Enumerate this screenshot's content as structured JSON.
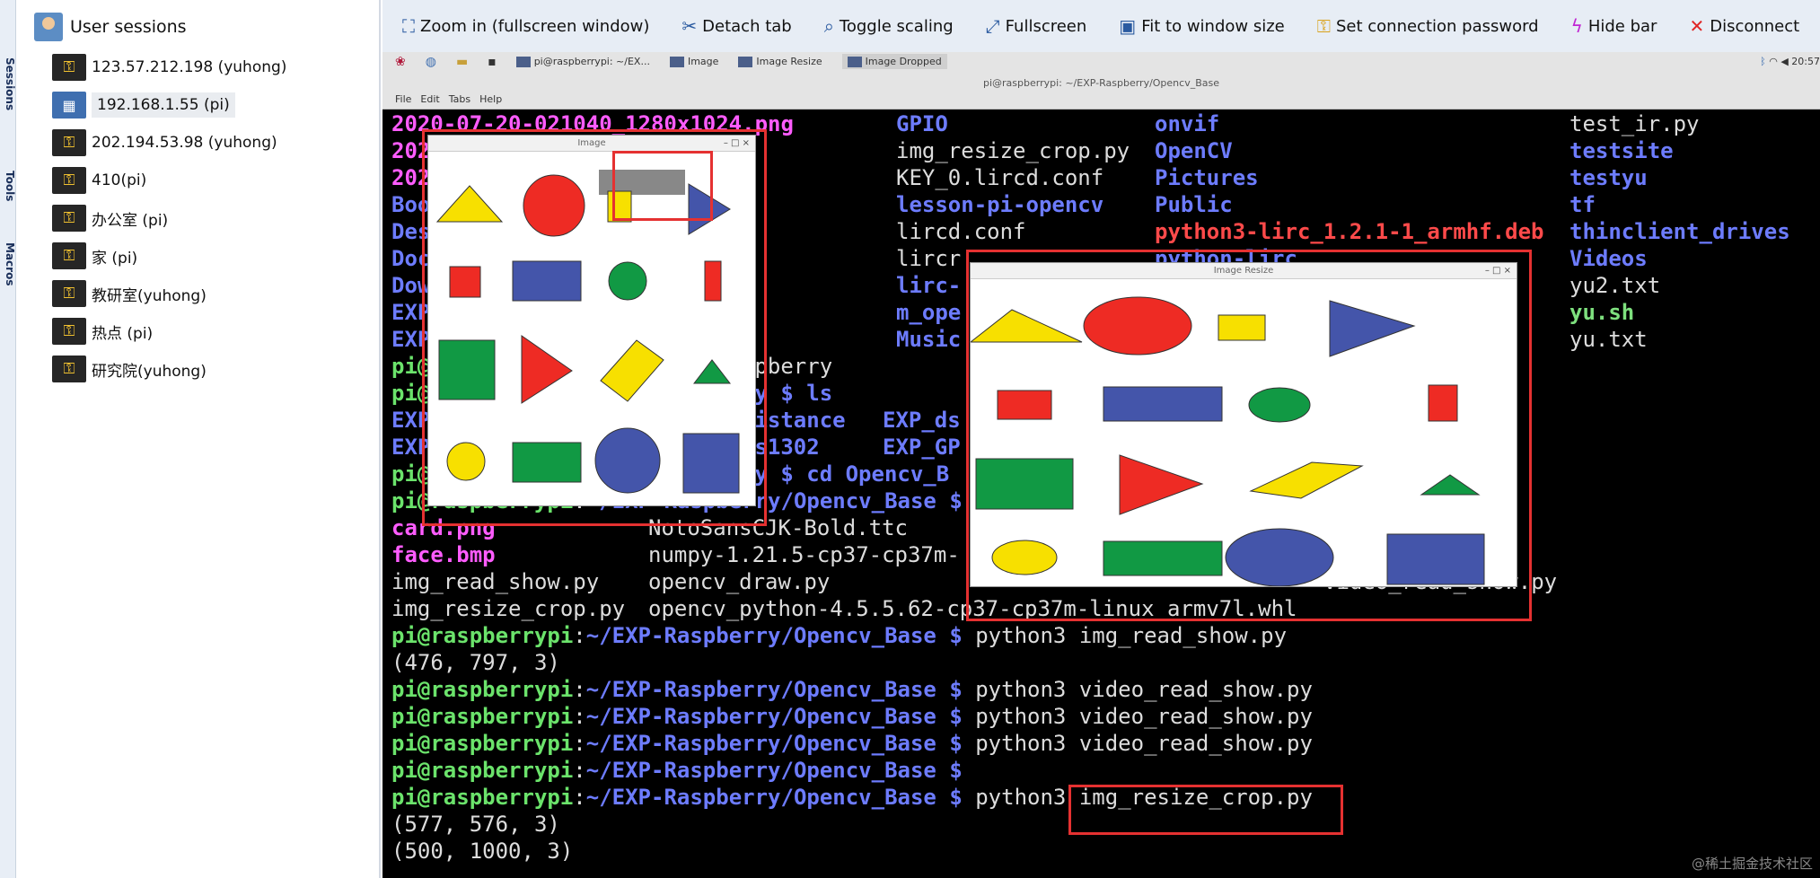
{
  "sidebar_tabs": [
    "Sessions",
    "Tools",
    "Macros"
  ],
  "sessions": {
    "header": "User sessions",
    "items": [
      {
        "label": "123.57.212.198 (yuhong)",
        "icon": "key-icon"
      },
      {
        "label": "192.168.1.55 (pi)",
        "icon": "windows-icon",
        "selected": true
      },
      {
        "label": "202.194.53.98 (yuhong)",
        "icon": "key-icon"
      },
      {
        "label": "410(pi)",
        "icon": "key-icon"
      },
      {
        "label": "办公室 (pi)",
        "icon": "key-icon"
      },
      {
        "label": "家 (pi)",
        "icon": "key-icon"
      },
      {
        "label": "教研室(yuhong)",
        "icon": "key-icon"
      },
      {
        "label": "热点 (pi)",
        "icon": "key-icon"
      },
      {
        "label": "研究院(yuhong)",
        "icon": "key-icon"
      }
    ]
  },
  "toolbar": {
    "zoom": "Zoom in (fullscreen window)",
    "detach": "Detach tab",
    "scaling": "Toggle scaling",
    "fullscreen": "Fullscreen",
    "fit": "Fit to window size",
    "password": "Set connection password",
    "hide": "Hide bar",
    "disconnect": "Disconnect"
  },
  "remote": {
    "taskbar": [
      "pi@raspberrypi: ~/EX...",
      "Image",
      "Image Resize",
      "Image Dropped"
    ],
    "clock": "20:57",
    "window_title": "pi@raspberrypi: ~/EXP-Raspberry/Opencv_Base",
    "menu": [
      "File",
      "Edit",
      "Tabs",
      "Help"
    ]
  },
  "terminal": {
    "prompt_user": "pi@raspberrypi",
    "prompt_path": "~/EXP-Raspberry/Opencv_Base $",
    "col1_top": "2020-07-20-021040_1280x1024.png",
    "col2": [
      "GPIO",
      "img_resize_crop.py",
      "KEY_0.lircd.conf",
      "lesson-pi-opencv",
      "lircd.conf",
      "lircr",
      "lirc-",
      "m_ope",
      "Music"
    ],
    "col3": [
      "onvif",
      "OpenCV",
      "Pictures",
      "Public",
      "python3-lirc_1.2.1-1_armhf.deb",
      "python-lirc"
    ],
    "col4": [
      "test_ir.py",
      "testsite",
      "testyu",
      "tf",
      "thinclient_drives",
      "Videos",
      "yu2.txt",
      "yu.sh",
      "yu.txt"
    ],
    "partial_left": [
      "202",
      "202",
      "Boo",
      "Des",
      "Doc",
      "Dow",
      "EXP",
      "EXP"
    ],
    "pi_rows": [
      "spberry",
      "ry $ ls",
      "ry $ cd Opencv_B"
    ],
    "exp_row1": [
      "Distance",
      "EXP_ds"
    ],
    "exp_row2": [
      "ds1302",
      "EXP_GP"
    ],
    "files_a": [
      "card.png",
      "face.bmp",
      "img_read_show.py",
      "img_resize_crop.py"
    ],
    "files_b": [
      "NotoSansCJK-Bold.ttc",
      "numpy-1.21.5-cp37-cp37m-",
      "opencv_draw.py",
      "opencv_python-4.5.5.62-cp37-cp37m-linux_armv7l.whl"
    ],
    "video_file": "video_read_show.py",
    "cmd1": "python3 img_read_show.py",
    "out1": "(476, 797, 3)",
    "cmd2": "python3 video_read_show.py",
    "cmd3": "python3",
    "cmd3_arg": "img_resize_crop.py",
    "out2": "(577, 576, 3)",
    "out3": "(500, 1000, 3)"
  },
  "cv_windows": {
    "image_title": "Image",
    "resize_title": "Image Resize",
    "controls": "– □ ×"
  },
  "colors": {
    "yellow": "#f7e000",
    "red": "#ee2b24",
    "blue": "#4455aa",
    "green": "#119944"
  },
  "watermark": "@稀土掘金技术社区"
}
